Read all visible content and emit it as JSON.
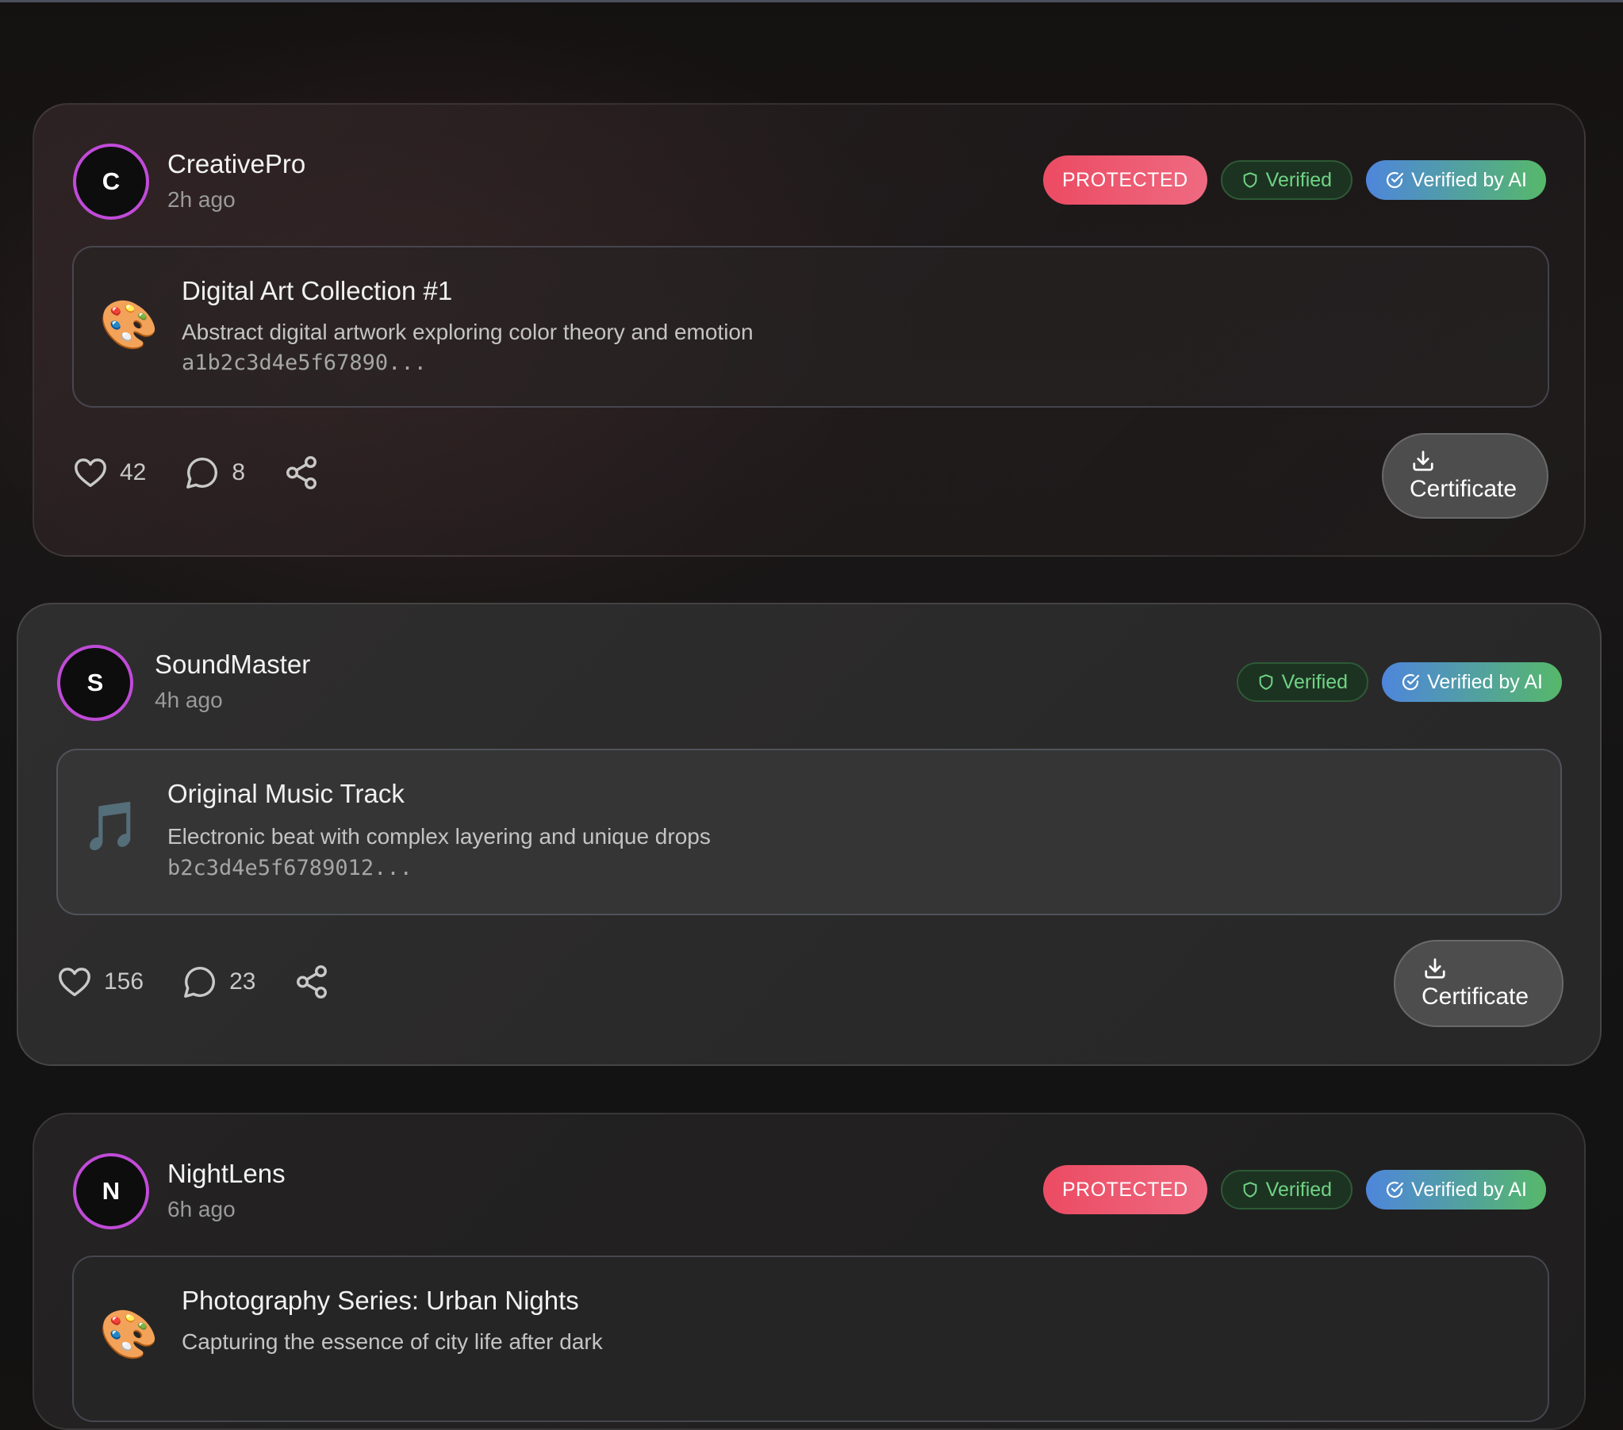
{
  "posts": [
    {
      "avatar_initial": "C",
      "username": "CreativePro",
      "time": "2h ago",
      "protected": true,
      "badges": {
        "protected_label": "PROTECTED",
        "verified_label": "Verified",
        "ai_label": "Verified by AI"
      },
      "content": {
        "icon": "palette-icon",
        "emoji": "🎨",
        "title": "Digital Art Collection #1",
        "description": "Abstract digital artwork exploring color theory and emotion",
        "hash": "a1b2c3d4e5f67890..."
      },
      "likes": "42",
      "comments": "8",
      "certificate_label": "Certificate"
    },
    {
      "avatar_initial": "S",
      "username": "SoundMaster",
      "time": "4h ago",
      "protected": false,
      "badges": {
        "verified_label": "Verified",
        "ai_label": "Verified by AI"
      },
      "content": {
        "icon": "music-notes-icon",
        "emoji": "🎵",
        "title": "Original Music Track",
        "description": "Electronic beat with complex layering and unique drops",
        "hash": "b2c3d4e5f6789012..."
      },
      "likes": "156",
      "comments": "23",
      "certificate_label": "Certificate"
    },
    {
      "avatar_initial": "N",
      "username": "NightLens",
      "time": "6h ago",
      "protected": true,
      "badges": {
        "protected_label": "PROTECTED",
        "verified_label": "Verified",
        "ai_label": "Verified by AI"
      },
      "content": {
        "icon": "palette-icon",
        "emoji": "🎨",
        "title": "Photography Series: Urban Nights",
        "description": "Capturing the essence of city life after dark"
      }
    }
  ],
  "colors": {
    "protected": "#ec4b63",
    "verified_text": "#6fd484",
    "ai_gradient_start": "#4e86dc",
    "ai_gradient_end": "#56b86a",
    "avatar_ring": "#c04bd8"
  }
}
